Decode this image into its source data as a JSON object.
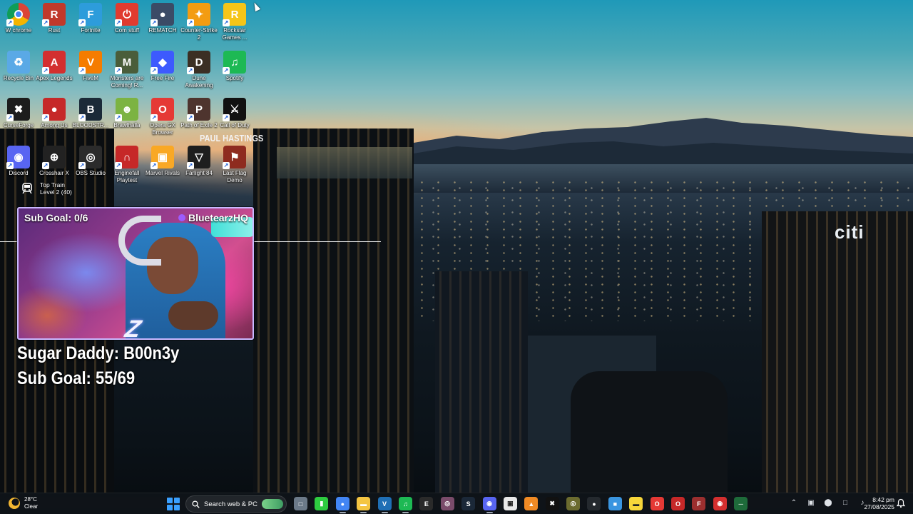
{
  "wallpaper": {
    "signs": [
      "citi",
      "PAUL HASTINGS"
    ]
  },
  "desktop": {
    "icons": [
      {
        "label": "W chrome",
        "color": "#ffffff",
        "icon": "chrome-icon"
      },
      {
        "label": "Rust",
        "color": "#c0392b",
        "icon": "rust-icon"
      },
      {
        "label": "Fortnite",
        "color": "#2d9cdb",
        "icon": "fortnite-icon"
      },
      {
        "label": "Com stuff",
        "color": "#e03b2f",
        "icon": "power-icon"
      },
      {
        "label": "REMATCH",
        "color": "#3b4b66",
        "icon": "rematch-icon"
      },
      {
        "label": "Counter-Strike 2",
        "color": "#f39c12",
        "icon": "counter-strike-icon"
      },
      {
        "label": "Rockstar Games ...",
        "color": "#f5c518",
        "icon": "rockstar-icon"
      },
      {
        "label": "Recycle Bin",
        "color": "#5aa9e6",
        "icon": "recycle-bin-icon"
      },
      {
        "label": "Apex Legends",
        "color": "#d32f2f",
        "icon": "apex-icon"
      },
      {
        "label": "FiveM",
        "color": "#f57c00",
        "icon": "fivem-icon"
      },
      {
        "label": "Monsters are Coming! R...",
        "color": "#4a5d3a",
        "icon": "monsters-icon"
      },
      {
        "label": "Free Fire",
        "color": "#3d5afe",
        "icon": "free-fire-icon"
      },
      {
        "label": "Dune Awakening",
        "color": "#3b2f24",
        "icon": "dune-icon"
      },
      {
        "label": "Spotify",
        "color": "#1db954",
        "icon": "spotify-icon"
      },
      {
        "label": "CurseForge",
        "color": "#1c1c1c",
        "icon": "curseforge-icon"
      },
      {
        "label": "Among Us",
        "color": "#c62828",
        "icon": "among-us-icon"
      },
      {
        "label": "BLOODSTR...",
        "color": "#1b2a38",
        "icon": "bloodstrike-icon"
      },
      {
        "label": "Brawlhalla",
        "color": "#7cb342",
        "icon": "brawlhalla-icon"
      },
      {
        "label": "Opera GX Browser",
        "color": "#e53935",
        "icon": "opera-gx-icon"
      },
      {
        "label": "Path of Exile 2",
        "color": "#4e342e",
        "icon": "path-of-exile-icon"
      },
      {
        "label": "Call of Duty",
        "color": "#111111",
        "icon": "call-of-duty-icon"
      },
      {
        "label": "Discord",
        "color": "#5865f2",
        "icon": "discord-icon"
      },
      {
        "label": "Crosshair X",
        "color": "#222222",
        "icon": "crosshair-icon"
      },
      {
        "label": "OBS Studio",
        "color": "#2b2b2b",
        "icon": "obs-icon"
      },
      {
        "label": "Enginefall Playtest",
        "color": "#c62828",
        "icon": "enginefall-icon"
      },
      {
        "label": "Marvel Rivals",
        "color": "#f9a825",
        "icon": "marvel-rivals-icon"
      },
      {
        "label": "Farlight 84",
        "color": "#1e1e1e",
        "icon": "farlight-icon"
      },
      {
        "label": "Last Flag Demo",
        "color": "#8e2b1f",
        "icon": "last-flag-icon"
      }
    ],
    "icon_glyphs": [
      "",
      "R",
      "F",
      "⏻",
      "●",
      "✦",
      "R",
      "♻",
      "A",
      "V",
      "M",
      "◆",
      "D",
      "♫",
      "✖",
      "●",
      "B",
      "☻",
      "O",
      "P",
      "⚔",
      "◉",
      "⊕",
      "◎",
      "∩",
      "▣",
      "▽",
      "⚑"
    ],
    "top_train": {
      "line1": "Top Train",
      "line2": "Level 2 (40)"
    }
  },
  "stream_overlay": {
    "cam_sub_goal": "Sub Goal: 0/6",
    "cam_channel": "BluetearzHQ",
    "cam_logo": "Z",
    "sugar_daddy": "Sugar Daddy: B00n3y",
    "sub_goal": "Sub Goal: 55/69"
  },
  "taskbar": {
    "weather": {
      "temp": "28°C",
      "condition": "Clear"
    },
    "search_placeholder": "Search web & PC",
    "apps": [
      {
        "name": "task-view",
        "color": "#6c7a89",
        "glyph": "□"
      },
      {
        "name": "green-app",
        "color": "#2ecc40",
        "glyph": "▮"
      },
      {
        "name": "chrome",
        "color": "#4285f4",
        "glyph": "●"
      },
      {
        "name": "file-explorer",
        "color": "#f4c542",
        "glyph": "▬"
      },
      {
        "name": "visual-studio",
        "color": "#1f6fb5",
        "glyph": "V"
      },
      {
        "name": "spotify",
        "color": "#1db954",
        "glyph": "♫"
      },
      {
        "name": "epic-games",
        "color": "#2a2a2a",
        "glyph": "E"
      },
      {
        "name": "obs",
        "color": "#7a4b6a",
        "glyph": "◎"
      },
      {
        "name": "steam",
        "color": "#1b2838",
        "glyph": "S"
      },
      {
        "name": "discord",
        "color": "#5865f2",
        "glyph": "◉"
      },
      {
        "name": "gallery",
        "color": "#e8e8e8",
        "glyph": "▣"
      },
      {
        "name": "vlc",
        "color": "#f08a24",
        "glyph": "▲"
      },
      {
        "name": "capcut",
        "color": "#111111",
        "glyph": "✖"
      },
      {
        "name": "app-circle",
        "color": "#6b6b2f",
        "glyph": "◎"
      },
      {
        "name": "github",
        "color": "#24292e",
        "glyph": "●"
      },
      {
        "name": "photos",
        "color": "#3a95e0",
        "glyph": "■"
      },
      {
        "name": "sticky-notes",
        "color": "#f7d63a",
        "glyph": "▬"
      },
      {
        "name": "opera",
        "color": "#e53935",
        "glyph": "O"
      },
      {
        "name": "opera-gx",
        "color": "#c62828",
        "glyph": "O"
      },
      {
        "name": "fortnite-tb",
        "color": "#9b2f2f",
        "glyph": "F"
      },
      {
        "name": "red-app",
        "color": "#d32f2f",
        "glyph": "◉"
      },
      {
        "name": "green-line",
        "color": "#1e6b3a",
        "glyph": "─"
      }
    ],
    "time": "8:42 pm",
    "date": "27/08/2025"
  }
}
